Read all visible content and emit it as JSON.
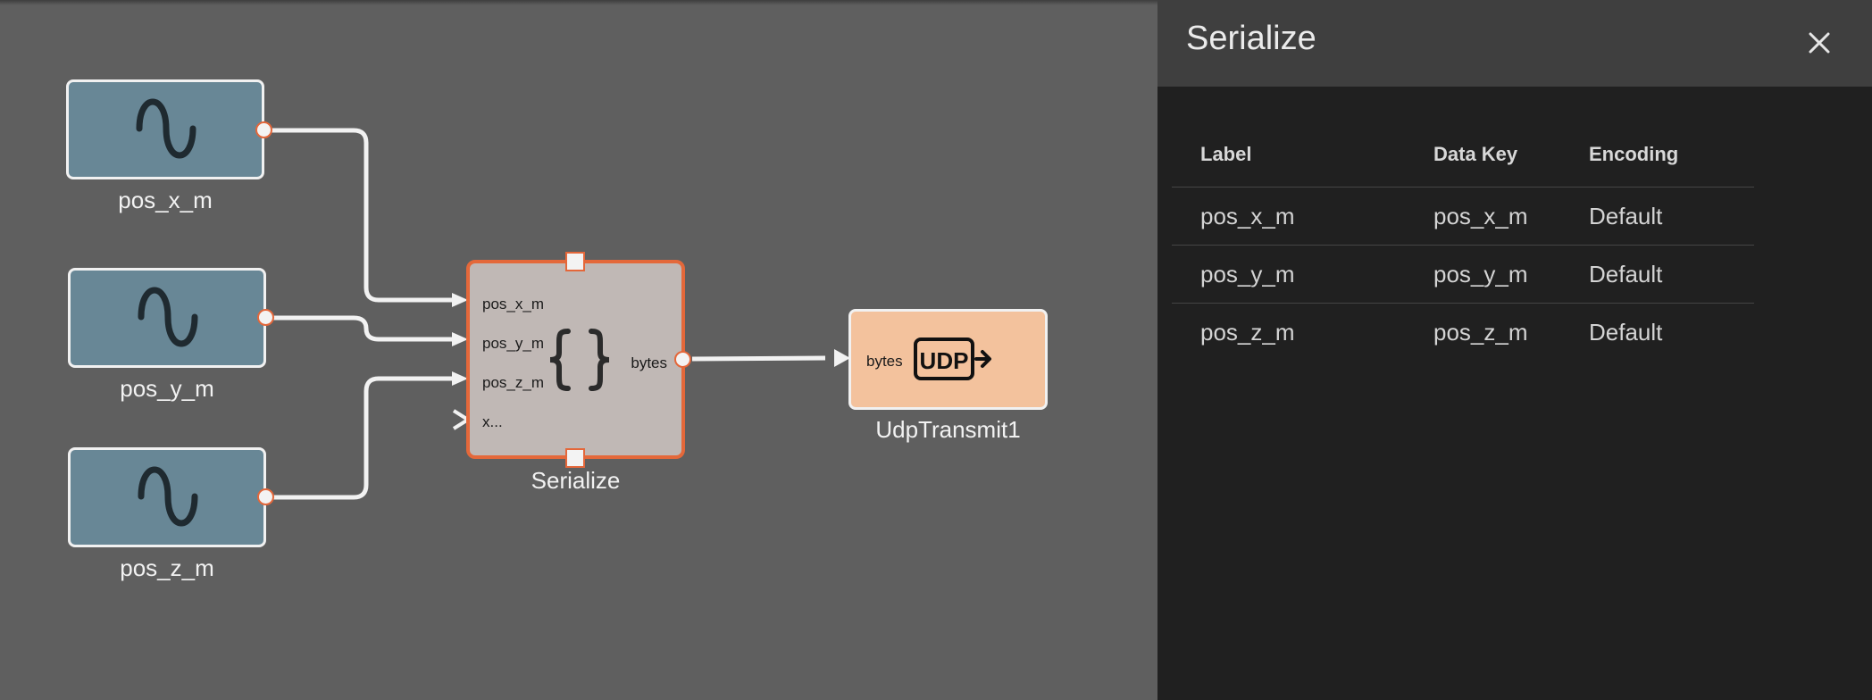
{
  "canvas": {
    "sources": [
      {
        "label": "pos_x_m",
        "icon": "sine-wave-icon"
      },
      {
        "label": "pos_y_m",
        "icon": "sine-wave-icon"
      },
      {
        "label": "pos_z_m",
        "icon": "sine-wave-icon"
      }
    ],
    "serialize_block": {
      "label": "Serialize",
      "inputs": [
        "pos_x_m",
        "pos_y_m",
        "pos_z_m",
        "x..."
      ],
      "output": "bytes",
      "icon": "curly-braces-icon"
    },
    "udp_block": {
      "label": "UdpTransmit1",
      "input": "bytes",
      "icon": "udp-transmit-icon"
    }
  },
  "panel": {
    "title": "Serialize",
    "close_icon": "close-icon",
    "table": {
      "headers": [
        "Label",
        "Data Key",
        "Encoding"
      ],
      "rows": [
        [
          "pos_x_m",
          "pos_x_m",
          "Default"
        ],
        [
          "pos_y_m",
          "pos_y_m",
          "Default"
        ],
        [
          "pos_z_m",
          "pos_z_m",
          "Default"
        ]
      ]
    }
  },
  "colors": {
    "canvas_bg": "#5f5f5f",
    "source_block": "#688796",
    "serialize_block": "#c0b8b5",
    "udp_block": "#f3c29d",
    "selection_accent": "#e4683a",
    "panel_bg": "#202020",
    "panel_header": "#3f3f3f"
  }
}
